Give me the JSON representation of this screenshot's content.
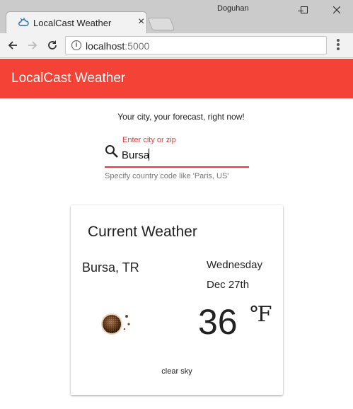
{
  "browser": {
    "tab_title": "LocalCast Weather",
    "tab_close": "×",
    "user_name": "Doguhan",
    "window_controls": {
      "minimize": "–",
      "maximize": "☐",
      "close": "✕"
    },
    "address": {
      "host": "localhost",
      "port": ":5000"
    },
    "icons": [
      "cloud-icon",
      "back-icon",
      "forward-icon",
      "reload-icon",
      "info-icon",
      "menu-icon"
    ]
  },
  "app": {
    "title": "LocalCast Weather",
    "tagline": "Your city, your forecast, right now!",
    "accent_color": "#f44336",
    "search": {
      "label": "Enter city or zip",
      "value": "Bursa",
      "hint": "Specify country code like 'Paris, US'"
    }
  },
  "current_weather": {
    "title": "Current Weather",
    "city": "Bursa, TR",
    "day": "Wednesday",
    "date": "Dec 27th",
    "temperature": "36",
    "unit": "℉",
    "description": "clear sky",
    "icon": "clear-sky-night-icon"
  }
}
